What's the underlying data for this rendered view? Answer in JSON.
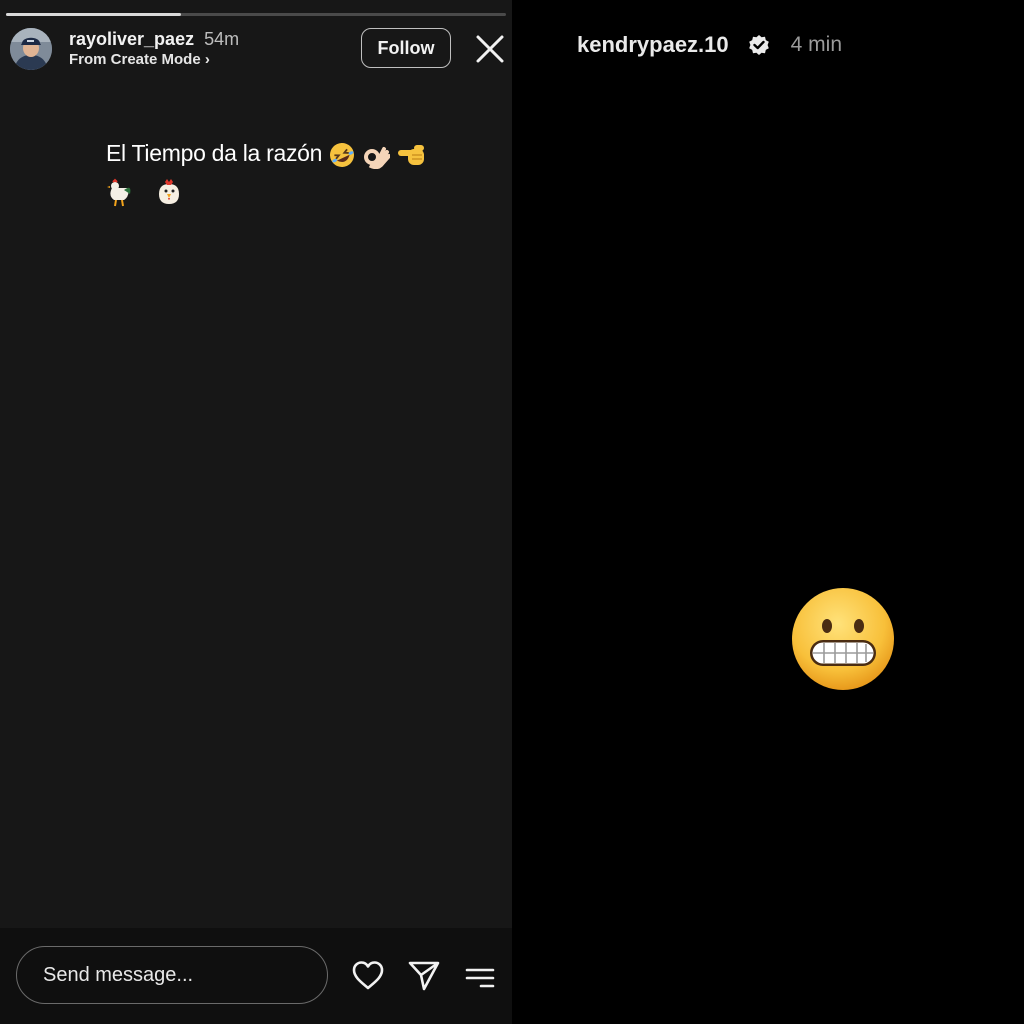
{
  "left_story": {
    "progress": 0.35,
    "username": "rayoliver_paez",
    "time_ago": "54m",
    "subtitle": "From Create Mode ›",
    "follow_label": "Follow",
    "caption_line1": "El Tiempo da la razón",
    "caption_line1_emojis": [
      "rolling-on-floor-laughing",
      "ok-hand",
      "backhand-index-pointing-left"
    ],
    "caption_line2_emojis": [
      "rooster",
      "chicken"
    ],
    "message_placeholder": "Send message...",
    "icons": {
      "like": "heart-icon",
      "share": "send-icon",
      "more": "menu-lines-icon",
      "close": "close-icon"
    }
  },
  "right_story": {
    "username": "kendrypaez.10",
    "verified": true,
    "time_ago": "4 min",
    "main_emoji": "grimacing-face"
  },
  "colors": {
    "left_background": "#171717",
    "right_background": "#000000",
    "emoji_yellow": "#f6c23e"
  }
}
